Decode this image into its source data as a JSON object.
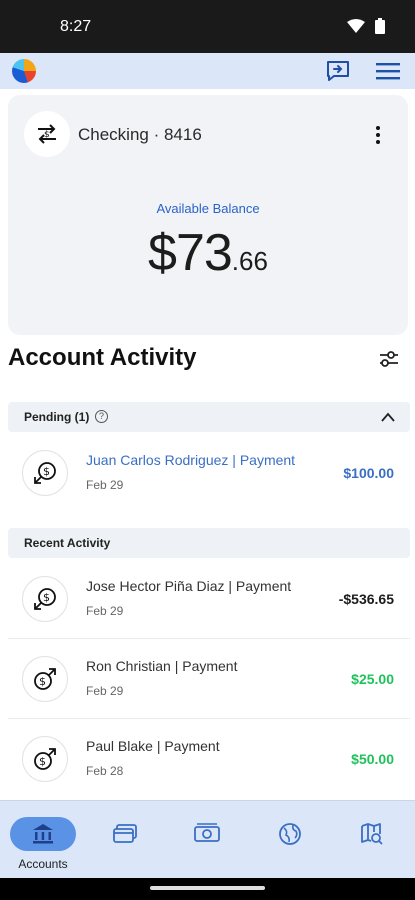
{
  "status_bar": {
    "time": "8:27"
  },
  "account_card": {
    "account_name": "Checking · 8416",
    "available_label": "Available Balance",
    "balance_main": "$73",
    "balance_cents": ".66"
  },
  "activity": {
    "title": "Account Activity",
    "pending": {
      "label": "Pending (1)",
      "items": [
        {
          "name": "Juan Carlos Rodriguez | Payment",
          "date": "Feb 29",
          "amount": "$100.00"
        }
      ]
    },
    "recent": {
      "label": "Recent Activity",
      "items": [
        {
          "name": "Jose Hector Piña Diaz | Payment",
          "date": "Feb 29",
          "amount": "-$536.65"
        },
        {
          "name": "Ron Christian | Payment",
          "date": "Feb 29",
          "amount": "$25.00"
        },
        {
          "name": "Paul Blake | Payment",
          "date": "Feb 28",
          "amount": "$50.00"
        }
      ]
    }
  },
  "bottom_nav": {
    "items": [
      {
        "label": "Accounts",
        "icon": "bank-icon",
        "active": true
      },
      {
        "label": "",
        "icon": "cards-icon",
        "active": false
      },
      {
        "label": "",
        "icon": "money-transfer-icon",
        "active": false
      },
      {
        "label": "",
        "icon": "globe-icon",
        "active": false
      },
      {
        "label": "",
        "icon": "map-search-icon",
        "active": false
      }
    ]
  },
  "colors": {
    "accent": "#3a6fc4",
    "header_bg": "#dbe7f8",
    "positive": "#1fc25a",
    "nav_active": "#5a92e6"
  }
}
